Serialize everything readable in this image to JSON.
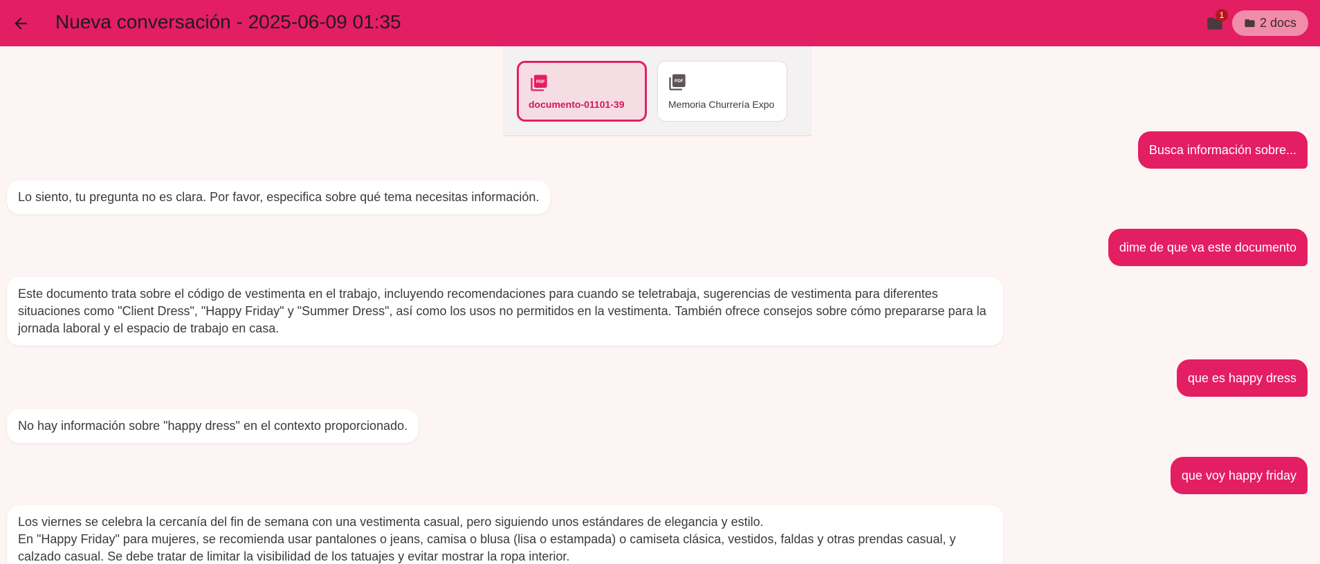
{
  "header": {
    "title": "Nueva conversación - 2025-06-09 01:35",
    "notification_count": "1",
    "docs_label": "2 docs",
    "back_icon": "arrow-left-icon",
    "folder_icon": "folder-icon"
  },
  "documents": [
    {
      "name": "documento-01101-39",
      "selected": true,
      "icon": "pdf-icon"
    },
    {
      "name": "Memoria Churrería Expo",
      "selected": false,
      "icon": "pdf-icon"
    }
  ],
  "messages": [
    {
      "role": "user",
      "text": "Busca información sobre..."
    },
    {
      "role": "bot",
      "text": "Lo siento, tu pregunta no es clara. Por favor, especifica sobre qué tema necesitas información."
    },
    {
      "role": "user",
      "text": "dime de que va este documento"
    },
    {
      "role": "bot",
      "text": "Este documento trata sobre el código de vestimenta en el trabajo, incluyendo recomendaciones para cuando se teletrabaja, sugerencias de vestimenta para diferentes situaciones como \"Client Dress\", \"Happy Friday\" y \"Summer Dress\", así como los usos no permitidos en la vestimenta. También ofrece consejos sobre cómo prepararse para la jornada laboral y el espacio de trabajo en casa."
    },
    {
      "role": "user",
      "text": "que es happy dress"
    },
    {
      "role": "bot",
      "text": "No hay información sobre \"happy dress\" en el contexto proporcionado."
    },
    {
      "role": "user",
      "text": "que voy happy friday"
    },
    {
      "role": "bot",
      "text": "Los viernes se celebra la cercanía del fin de semana con una vestimenta casual, pero siguiendo unos estándares de elegancia y estilo.\nEn \"Happy Friday\" para mujeres, se recomienda usar pantalones o jeans, camisa o blusa (lisa o estampada) o camiseta clásica, vestidos, faldas y otras prendas casual, y calzado casual. Se debe tratar de limitar la visibilidad de los tatuajes y evitar mostrar la ropa interior."
    }
  ],
  "colors": {
    "primary": "#e31e63",
    "background": "#fdf5f4",
    "badge": "#b3171c",
    "chip": "#f28cab"
  }
}
